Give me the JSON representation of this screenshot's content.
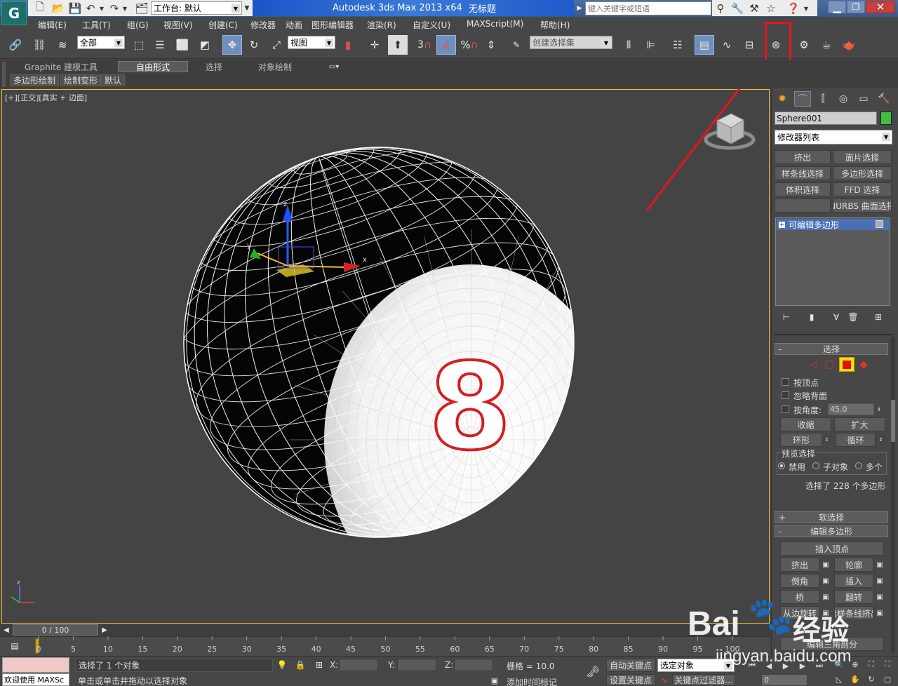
{
  "titlebar": {
    "workspace_label": "工作台: 默认",
    "app_title": "Autodesk 3ds Max  2013 x64",
    "doc_title": "无标题",
    "search_placeholder": "键入关键字或短语"
  },
  "menu": [
    "编辑(E)",
    "工具(T)",
    "组(G)",
    "视图(V)",
    "创建(C)",
    "修改器",
    "动画",
    "图形编辑器",
    "渲染(R)",
    "自定义(U)",
    "MAXScript(M)",
    "帮助(H)"
  ],
  "toolbar": {
    "filter_value": "全部",
    "refcoord_value": "视图",
    "snap_three": "3",
    "percent": "%",
    "selset_value": "创建选择集"
  },
  "ribbon": {
    "tabs": [
      "Graphite 建模工具",
      "自由形式",
      "选择",
      "对象绘制"
    ],
    "subtabs": [
      "多边形绘制",
      "绘制变形",
      "默认"
    ]
  },
  "viewport": {
    "label": "[+][正交][真实 + 边面]",
    "object_number": "8",
    "gizmo_axes": {
      "x": "x",
      "y": "y",
      "z": "z"
    }
  },
  "panel": {
    "object_name": "Sphere001",
    "object_color": "#40c040",
    "modifier_list": "修改器列表",
    "quick_buttons": [
      "挤出",
      "面片选择",
      "样条线选择",
      "多边形选择",
      "体积选择",
      "FFD 选择",
      "",
      "NURBS 曲面选择"
    ],
    "stack_item": "可编辑多边形",
    "rollout_select": {
      "title": "选择",
      "by_vertex": "按顶点",
      "ignore_back": "忽略背面",
      "by_angle": "按角度:",
      "angle_value": "45.0",
      "shrink": "收缩",
      "grow": "扩大",
      "ring": "环形",
      "loop": "循环",
      "preview_title": "预览选择",
      "preview_options": [
        "禁用",
        "子对象",
        "多个"
      ],
      "status": "选择了 228 个多边形"
    },
    "soft_select": "软选择",
    "edit_poly": {
      "title": "编辑多边形",
      "insert_vertex": "插入顶点",
      "buttons": [
        "挤出",
        "轮廓",
        "倒角",
        "插入",
        "桥",
        "翻转",
        "从边旋转",
        "沿样条线挤出"
      ],
      "edit_tri": "编辑三角剖分"
    }
  },
  "timeline": {
    "frame": "0 / 100",
    "ticks": [
      "0",
      "5",
      "10",
      "15",
      "20",
      "25",
      "30",
      "35",
      "40",
      "45",
      "50",
      "55",
      "60",
      "65",
      "70",
      "75",
      "80",
      "85",
      "90",
      "95",
      "100"
    ]
  },
  "status": {
    "maxscript": "欢迎使用 MAXSc",
    "selected": "选择了 1 个对象",
    "hint": "单击或单击并拖动以选择对象",
    "x_label": "X:",
    "y_label": "Y:",
    "z_label": "Z:",
    "grid": "栅格 = 10.0",
    "auto_key": "自动关键点",
    "set_key": "设置关键点",
    "key_mode": "选定对象",
    "key_filters": "关键点过滤器...",
    "add_time_tag": "添加时间标记",
    "frame_field": "0"
  },
  "watermark": {
    "brand": "Bai",
    "brand_cn": "经验",
    "url": "jingyan.baidu.com"
  }
}
